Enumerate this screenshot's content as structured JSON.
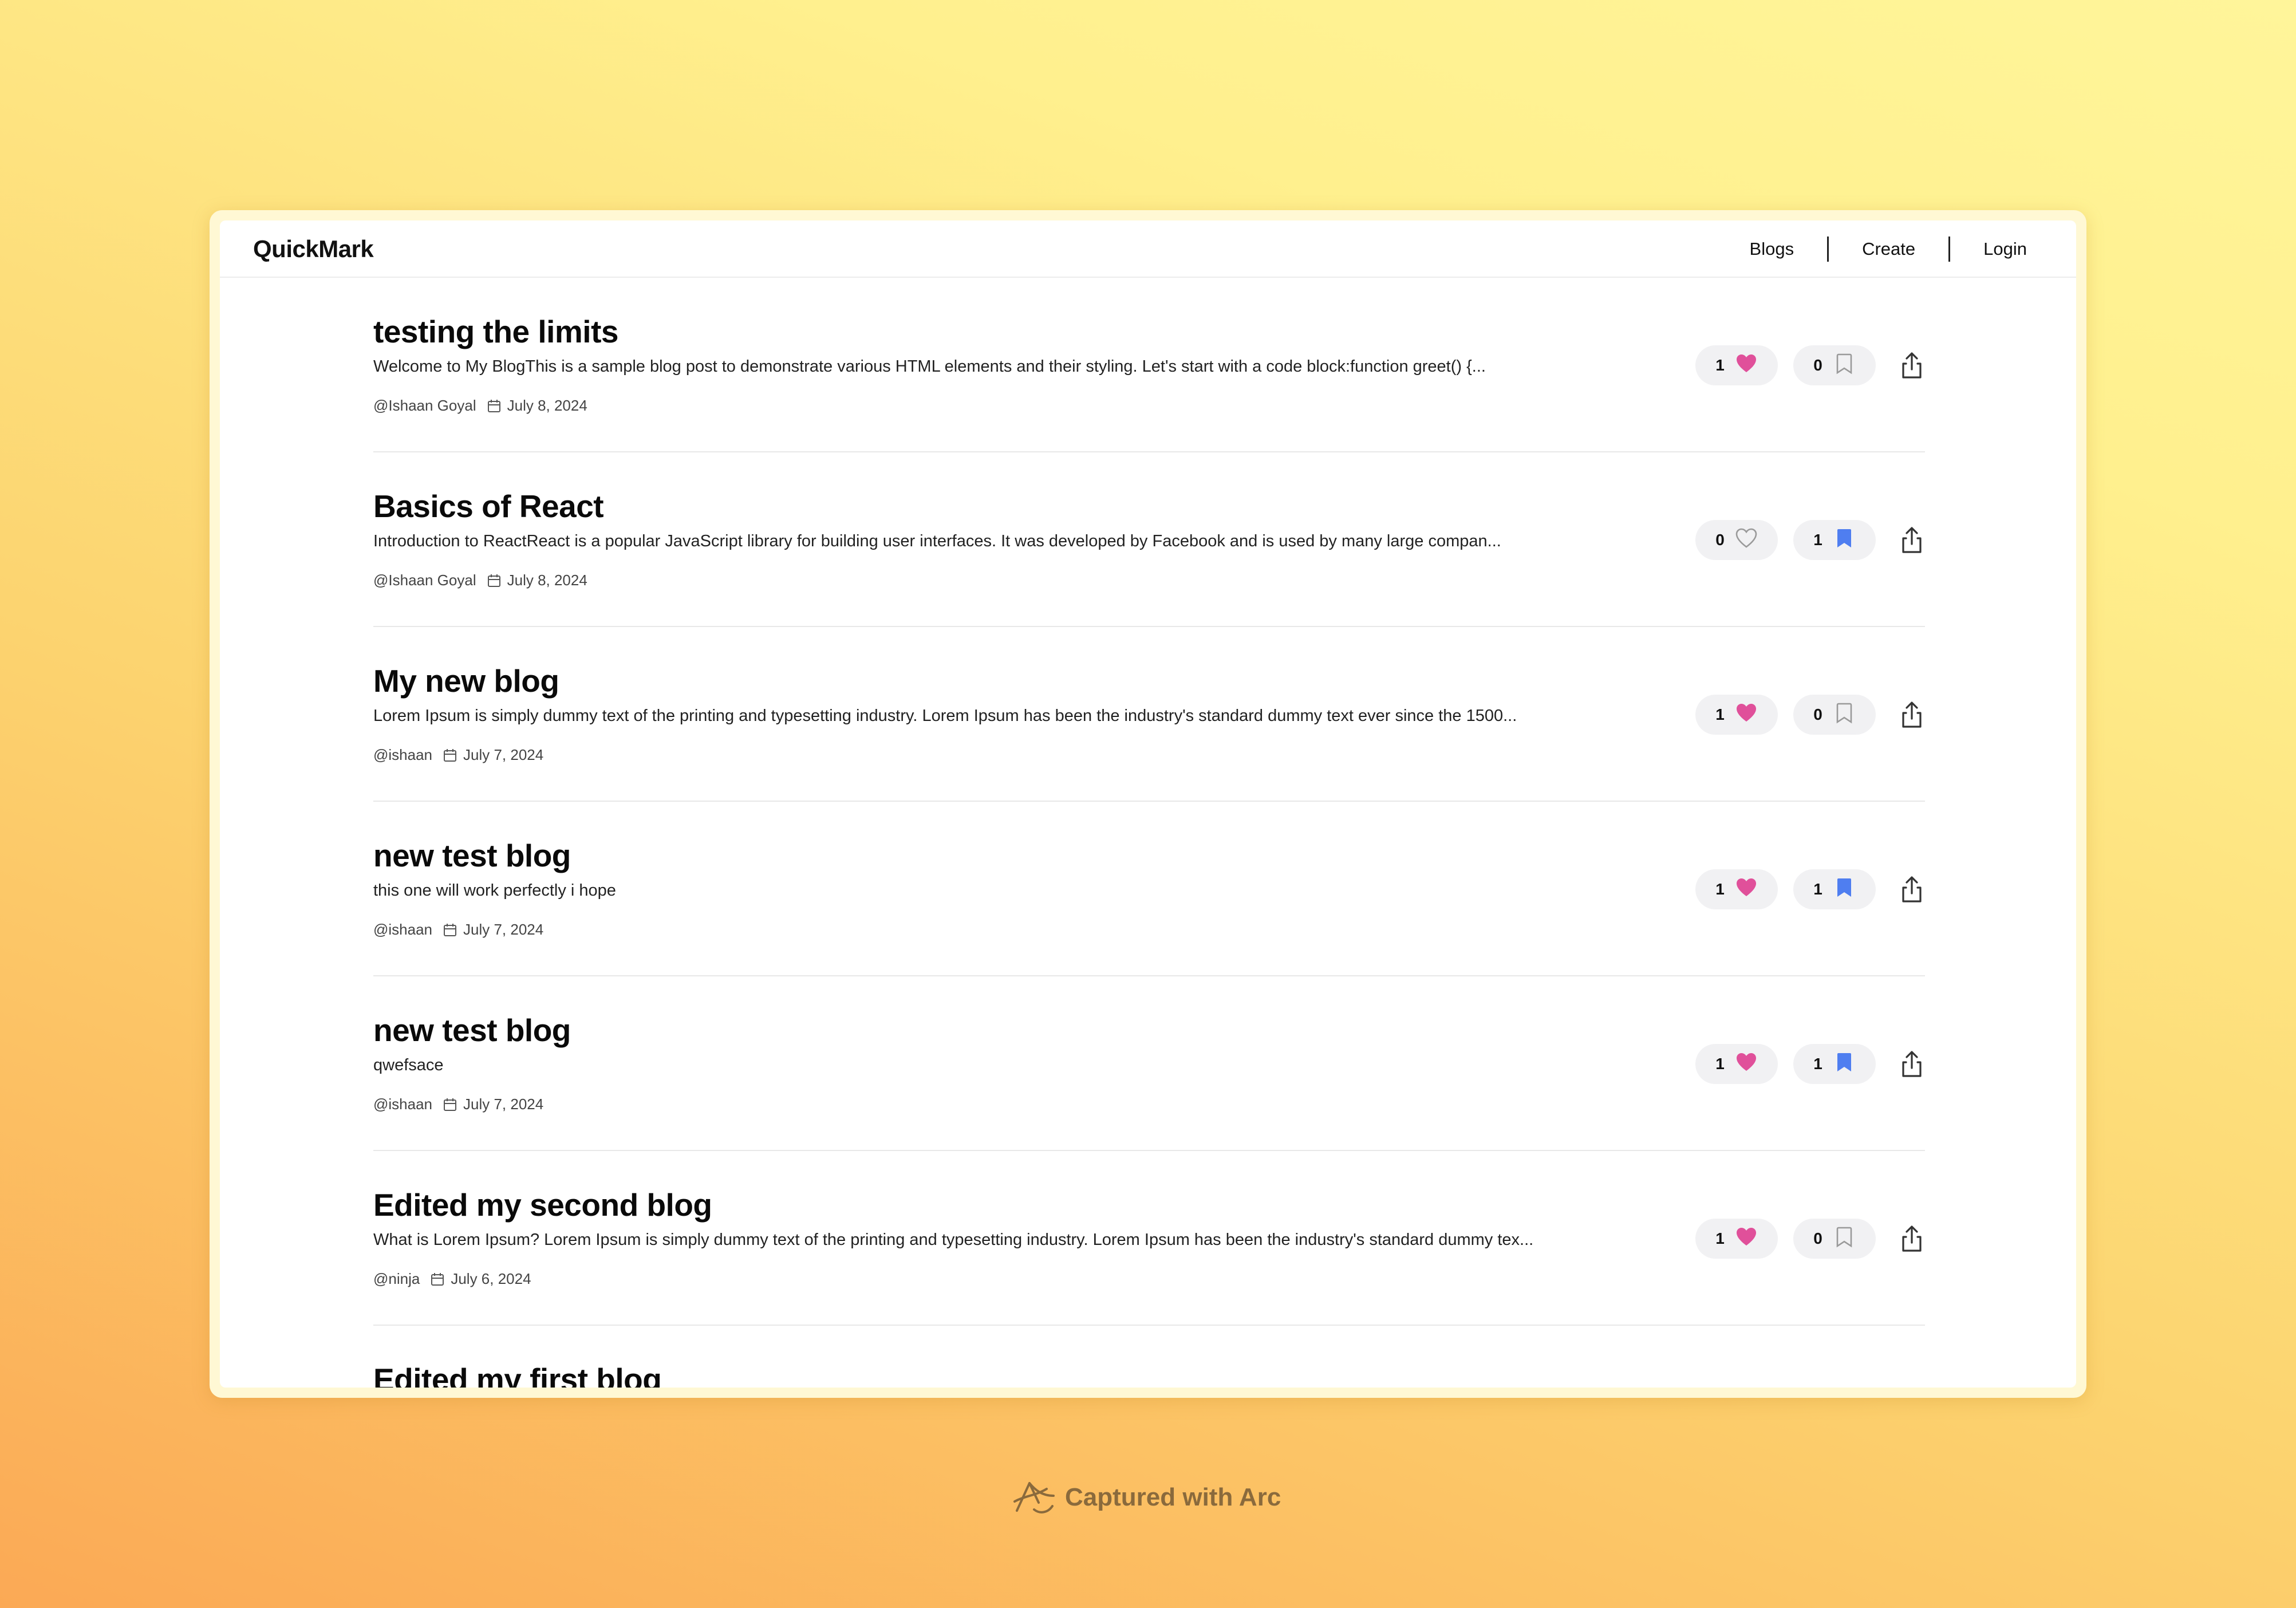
{
  "app": {
    "brand": "QuickMark",
    "nav": [
      "Blogs",
      "Create",
      "Login"
    ]
  },
  "posts": [
    {
      "title": "testing the limits",
      "excerpt": "Welcome to My BlogThis is a sample blog post to demonstrate various HTML elements and their styling. Let's start with a code block:function greet() {...",
      "author": "@Ishaan Goyal",
      "date": "July 8, 2024",
      "likes": "1",
      "liked": true,
      "bookmarks": "0",
      "bookmarked": false
    },
    {
      "title": "Basics of React",
      "excerpt": "Introduction to ReactReact is a popular JavaScript library for building user interfaces. It was developed by Facebook and is used by many large compan...",
      "author": "@Ishaan Goyal",
      "date": "July 8, 2024",
      "likes": "0",
      "liked": false,
      "bookmarks": "1",
      "bookmarked": true
    },
    {
      "title": "My new blog",
      "excerpt": "Lorem Ipsum is simply dummy text of the printing and typesetting industry. Lorem Ipsum has been the industry's standard dummy text ever since the 1500...",
      "author": "@ishaan",
      "date": "July 7, 2024",
      "likes": "1",
      "liked": true,
      "bookmarks": "0",
      "bookmarked": false
    },
    {
      "title": "new test blog",
      "excerpt": "this one will work perfectly i hope",
      "author": "@ishaan",
      "date": "July 7, 2024",
      "likes": "1",
      "liked": true,
      "bookmarks": "1",
      "bookmarked": true
    },
    {
      "title": "new test blog",
      "excerpt": "qwefsace",
      "author": "@ishaan",
      "date": "July 7, 2024",
      "likes": "1",
      "liked": true,
      "bookmarks": "1",
      "bookmarked": true
    },
    {
      "title": "Edited my second blog",
      "excerpt": "What is Lorem Ipsum? Lorem Ipsum is simply dummy text of the printing and typesetting industry. Lorem Ipsum has been the industry's standard dummy tex...",
      "author": "@ninja",
      "date": "July 6, 2024",
      "likes": "1",
      "liked": true,
      "bookmarks": "0",
      "bookmarked": false
    },
    {
      "title": "Edited my first blog",
      "excerpt": "",
      "author": "",
      "date": "",
      "likes": "",
      "liked": false,
      "bookmarks": "",
      "bookmarked": false
    }
  ],
  "icons": {
    "like": "heart-icon",
    "bookmark": "bookmark-icon",
    "share": "share-icon",
    "date": "calendar-icon"
  },
  "colors": {
    "like_active": "#e0509a",
    "bookmark_active": "#4f7ef0",
    "inactive_icon": "#9a9a9a"
  },
  "footer": {
    "capture_label": "Captured with Arc"
  }
}
